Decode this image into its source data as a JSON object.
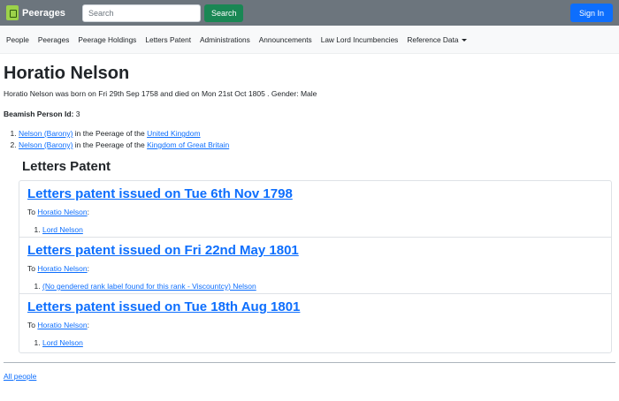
{
  "navbar": {
    "brand": "Peerages",
    "search_placeholder": "Search",
    "search_button": "Search",
    "signin_button": "Sign In",
    "brand_color": "#9cd24a",
    "bar_color": "#6c757d"
  },
  "subnav": {
    "items": [
      "People",
      "Peerages",
      "Peerage Holdings",
      "Letters Patent",
      "Administrations",
      "Announcements",
      "Law Lord Incumbencies",
      "Reference Data"
    ]
  },
  "person": {
    "name": "Horatio Nelson",
    "bio": "Horatio Nelson was born on Fri 29th Sep 1758 and died on Mon 21st Oct 1805 . Gender: Male",
    "id_label": "Beamish Person Id",
    "id_value": "3"
  },
  "peerages": [
    {
      "title": "Nelson (Barony)",
      "text": "in the Peerage of the",
      "kingdom": "United Kingdom"
    },
    {
      "title": "Nelson (Barony)",
      "text": "in the Peerage of the",
      "kingdom": "Kingdom of Great Britain"
    }
  ],
  "letters_patent": {
    "heading": "Letters Patent",
    "to_label": "To",
    "items": [
      {
        "title": "Letters patent issued on Tue 6th Nov 1798",
        "recipient": "Horatio Nelson",
        "rank": "Lord Nelson"
      },
      {
        "title": "Letters patent issued on Fri 22nd May 1801",
        "recipient": "Horatio Nelson",
        "rank": "(No gendered rank label found for this rank - Viscountcy) Nelson"
      },
      {
        "title": "Letters patent issued on Tue 18th Aug 1801",
        "recipient": "Horatio Nelson",
        "rank": "Lord Nelson"
      }
    ]
  },
  "footer": {
    "all_people": "All people"
  }
}
